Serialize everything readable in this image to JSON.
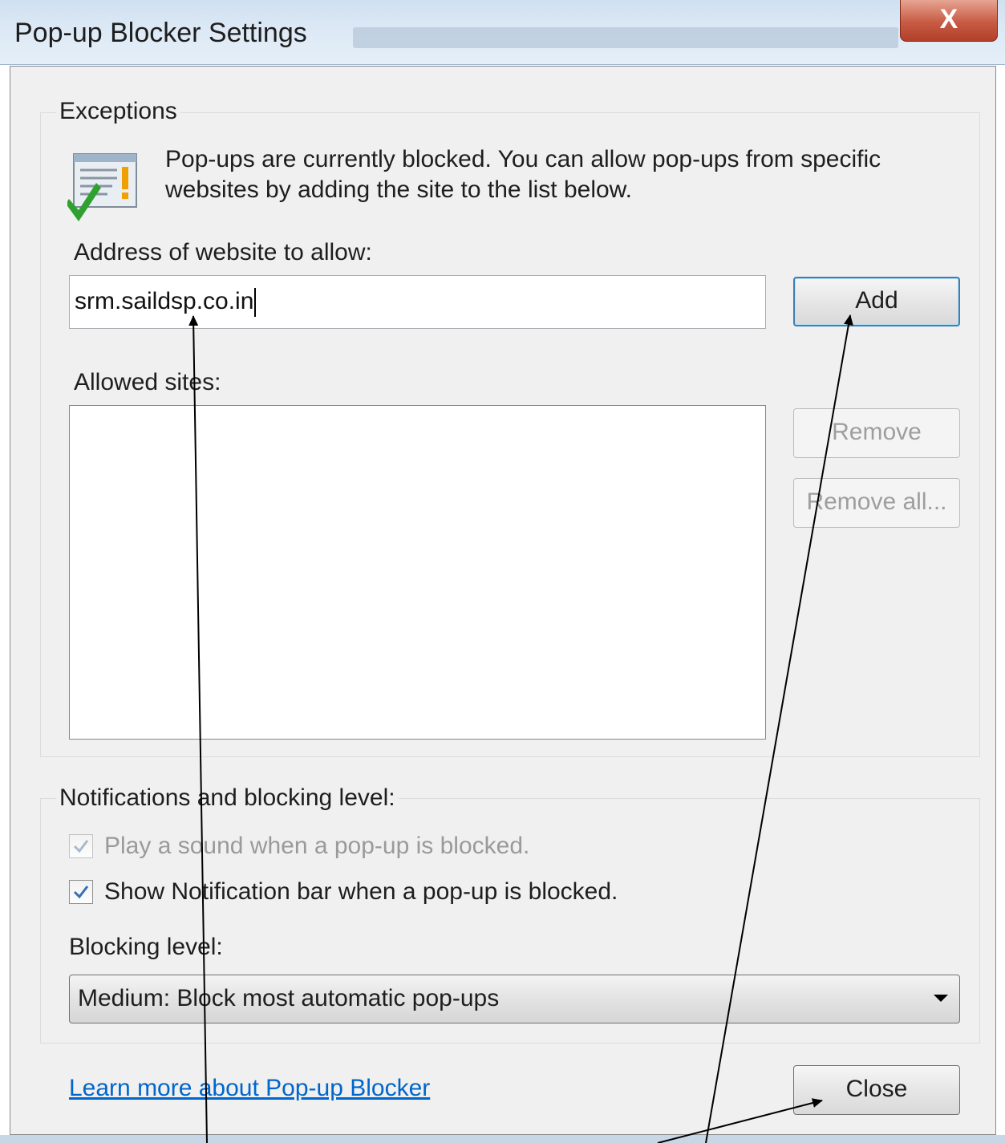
{
  "window": {
    "title": "Pop-up Blocker Settings",
    "close_glyph": "X"
  },
  "exceptions": {
    "group_label": "Exceptions",
    "info_icon": "shield-check-warning-icon",
    "info_text": "Pop-ups are currently blocked.  You can allow pop-ups from specific websites by adding the site to the list below.",
    "address_label": "Address of website to allow:",
    "address_value": "srm.saildsp.co.in",
    "add_button": "Add",
    "allowed_label": "Allowed sites:",
    "allowed_sites": [],
    "remove_button": "Remove",
    "remove_all_button": "Remove all..."
  },
  "notifications": {
    "group_label": "Notifications and blocking level:",
    "play_sound_label": "Play a sound when a pop-up is blocked.",
    "play_sound_checked": true,
    "play_sound_enabled": false,
    "show_bar_label": "Show Notification bar when a pop-up is blocked.",
    "show_bar_checked": true,
    "blocking_level_label": "Blocking level:",
    "blocking_level_value": "Medium: Block most automatic pop-ups"
  },
  "footer": {
    "learn_more_link": "Learn more about Pop-up Blocker",
    "close_button": "Close"
  },
  "colors": {
    "dialog_bg": "#f0f0f0",
    "link": "#0066cc",
    "default_button_border": "#3c7fb1",
    "close_x_bg": "#c75b43",
    "checkmark": "#3a6fb0"
  }
}
